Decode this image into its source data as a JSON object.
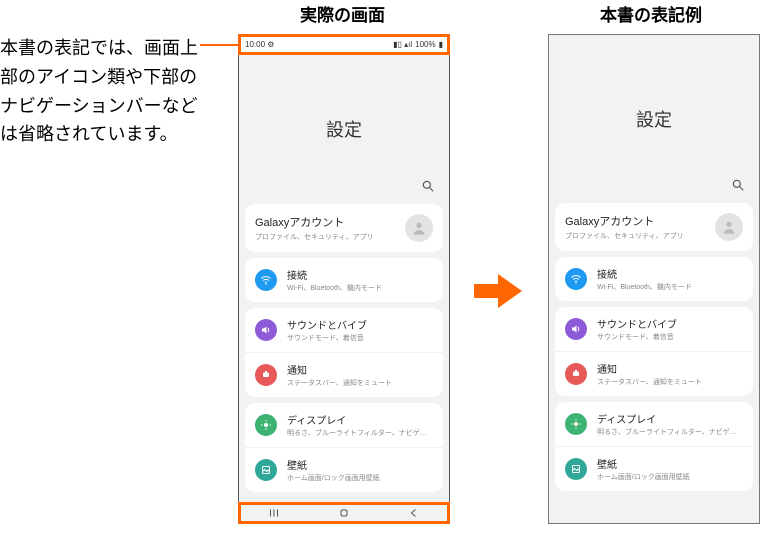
{
  "caption": "本書の表記では、画面上部のアイコン類や下部のナビゲーションバーなどは省略されています。",
  "labels": {
    "left": "実際の画面",
    "right": "本書の表記例"
  },
  "status": {
    "time": "10:00",
    "battery": "100%"
  },
  "settings": {
    "title": "設定",
    "account": {
      "title": "Galaxyアカウント",
      "sub": "プロファイル、セキュリティ、アプリ"
    },
    "groups": [
      {
        "icon": "wifi",
        "color": "bg-blue",
        "title": "接続",
        "sub": "Wi-Fi、Bluetooth、機内モード"
      },
      {
        "icon": "sound",
        "color": "bg-purple",
        "title": "サウンドとバイブ",
        "sub": "サウンドモード、着信音"
      },
      {
        "icon": "notif",
        "color": "bg-red",
        "title": "通知",
        "sub": "ステータスバー、通知をミュート"
      },
      {
        "icon": "display",
        "color": "bg-green",
        "title": "ディスプレイ",
        "sub": "明るさ、ブルーライトフィルター、ナビゲーションバー"
      },
      {
        "icon": "wall",
        "color": "bg-teal",
        "title": "壁紙",
        "sub": "ホーム画面/ロック画面用壁紙"
      }
    ]
  }
}
